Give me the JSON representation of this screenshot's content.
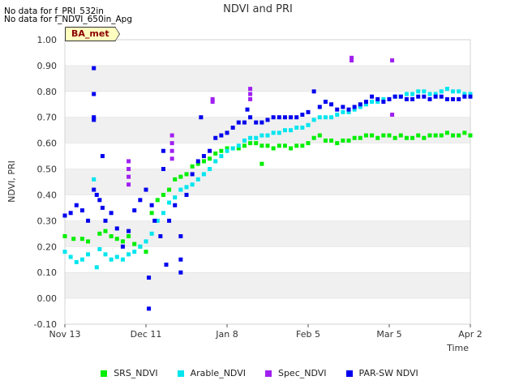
{
  "chart_data": {
    "type": "scatter",
    "title": "NDVI and PRI",
    "xlabel": "Time",
    "ylabel": "NDVI, PRI",
    "ylim": [
      -0.1,
      1.0
    ],
    "yticks": [
      -0.1,
      0.0,
      0.1,
      0.2,
      0.3,
      0.4,
      0.5,
      0.6,
      0.7,
      0.8,
      0.9,
      1.0
    ],
    "ytick_labels": [
      "-0.10",
      "0.00",
      "0.10",
      "0.20",
      "0.30",
      "0.40",
      "0.50",
      "0.60",
      "0.70",
      "0.80",
      "0.90",
      "1.00"
    ],
    "xlim_days": [
      0,
      140
    ],
    "xticks_days": [
      0,
      28,
      56,
      84,
      112,
      140
    ],
    "xtick_labels": [
      "Nov 13",
      "Dec 11",
      "Jan 8",
      "Feb 5",
      "Mar 5",
      "Apr 2"
    ],
    "grid": "horizontal bands",
    "legend_position": "bottom",
    "series": [
      {
        "name": "SRS_NDVI",
        "color": "#00ee00",
        "points": [
          [
            0,
            0.24
          ],
          [
            3,
            0.23
          ],
          [
            6,
            0.23
          ],
          [
            8,
            0.22
          ],
          [
            12,
            0.25
          ],
          [
            14,
            0.26
          ],
          [
            16,
            0.24
          ],
          [
            18,
            0.23
          ],
          [
            20,
            0.22
          ],
          [
            22,
            0.24
          ],
          [
            24,
            0.21
          ],
          [
            26,
            0.2
          ],
          [
            28,
            0.18
          ],
          [
            30,
            0.33
          ],
          [
            32,
            0.38
          ],
          [
            34,
            0.4
          ],
          [
            36,
            0.42
          ],
          [
            38,
            0.46
          ],
          [
            40,
            0.47
          ],
          [
            42,
            0.48
          ],
          [
            44,
            0.51
          ],
          [
            46,
            0.52
          ],
          [
            48,
            0.53
          ],
          [
            50,
            0.54
          ],
          [
            52,
            0.56
          ],
          [
            54,
            0.57
          ],
          [
            56,
            0.58
          ],
          [
            58,
            0.58
          ],
          [
            60,
            0.58
          ],
          [
            62,
            0.59
          ],
          [
            64,
            0.6
          ],
          [
            66,
            0.6
          ],
          [
            68,
            0.59
          ],
          [
            68,
            0.52
          ],
          [
            70,
            0.59
          ],
          [
            72,
            0.58
          ],
          [
            74,
            0.59
          ],
          [
            76,
            0.59
          ],
          [
            78,
            0.58
          ],
          [
            80,
            0.59
          ],
          [
            82,
            0.59
          ],
          [
            84,
            0.6
          ],
          [
            86,
            0.62
          ],
          [
            88,
            0.63
          ],
          [
            90,
            0.61
          ],
          [
            92,
            0.61
          ],
          [
            94,
            0.6
          ],
          [
            96,
            0.61
          ],
          [
            98,
            0.61
          ],
          [
            100,
            0.62
          ],
          [
            102,
            0.62
          ],
          [
            104,
            0.63
          ],
          [
            106,
            0.63
          ],
          [
            108,
            0.62
          ],
          [
            110,
            0.63
          ],
          [
            112,
            0.63
          ],
          [
            114,
            0.62
          ],
          [
            116,
            0.63
          ],
          [
            118,
            0.62
          ],
          [
            120,
            0.62
          ],
          [
            122,
            0.63
          ],
          [
            124,
            0.62
          ],
          [
            126,
            0.63
          ],
          [
            128,
            0.63
          ],
          [
            130,
            0.63
          ],
          [
            132,
            0.64
          ],
          [
            134,
            0.63
          ],
          [
            136,
            0.63
          ],
          [
            138,
            0.64
          ],
          [
            140,
            0.63
          ]
        ]
      },
      {
        "name": "Arable_NDVI",
        "color": "#00e5ee",
        "points": [
          [
            0,
            0.18
          ],
          [
            2,
            0.16
          ],
          [
            4,
            0.14
          ],
          [
            6,
            0.15
          ],
          [
            8,
            0.17
          ],
          [
            10,
            0.46
          ],
          [
            11,
            0.12
          ],
          [
            12,
            0.19
          ],
          [
            14,
            0.17
          ],
          [
            16,
            0.15
          ],
          [
            18,
            0.16
          ],
          [
            20,
            0.15
          ],
          [
            22,
            0.17
          ],
          [
            24,
            0.18
          ],
          [
            26,
            0.2
          ],
          [
            28,
            0.22
          ],
          [
            30,
            0.25
          ],
          [
            32,
            0.3
          ],
          [
            34,
            0.33
          ],
          [
            36,
            0.37
          ],
          [
            38,
            0.39
          ],
          [
            40,
            0.42
          ],
          [
            42,
            0.43
          ],
          [
            44,
            0.44
          ],
          [
            46,
            0.46
          ],
          [
            48,
            0.48
          ],
          [
            50,
            0.5
          ],
          [
            52,
            0.53
          ],
          [
            54,
            0.55
          ],
          [
            56,
            0.57
          ],
          [
            58,
            0.58
          ],
          [
            60,
            0.59
          ],
          [
            62,
            0.61
          ],
          [
            64,
            0.62
          ],
          [
            66,
            0.62
          ],
          [
            68,
            0.63
          ],
          [
            70,
            0.63
          ],
          [
            72,
            0.64
          ],
          [
            74,
            0.64
          ],
          [
            76,
            0.65
          ],
          [
            78,
            0.65
          ],
          [
            80,
            0.66
          ],
          [
            82,
            0.66
          ],
          [
            84,
            0.67
          ],
          [
            86,
            0.69
          ],
          [
            88,
            0.7
          ],
          [
            90,
            0.7
          ],
          [
            92,
            0.7
          ],
          [
            94,
            0.71
          ],
          [
            96,
            0.72
          ],
          [
            98,
            0.72
          ],
          [
            100,
            0.73
          ],
          [
            102,
            0.74
          ],
          [
            104,
            0.75
          ],
          [
            106,
            0.76
          ],
          [
            108,
            0.76
          ],
          [
            110,
            0.77
          ],
          [
            112,
            0.77
          ],
          [
            114,
            0.78
          ],
          [
            116,
            0.78
          ],
          [
            118,
            0.79
          ],
          [
            120,
            0.79
          ],
          [
            122,
            0.8
          ],
          [
            124,
            0.8
          ],
          [
            126,
            0.79
          ],
          [
            128,
            0.79
          ],
          [
            130,
            0.8
          ],
          [
            132,
            0.81
          ],
          [
            134,
            0.8
          ],
          [
            136,
            0.8
          ],
          [
            138,
            0.79
          ],
          [
            140,
            0.79
          ]
        ]
      },
      {
        "name": "Spec_NDVI",
        "color": "#a020f0",
        "points": [
          [
            22,
            0.53
          ],
          [
            22,
            0.5
          ],
          [
            22,
            0.47
          ],
          [
            22,
            0.44
          ],
          [
            37,
            0.63
          ],
          [
            37,
            0.6
          ],
          [
            37,
            0.57
          ],
          [
            37,
            0.54
          ],
          [
            51,
            0.77
          ],
          [
            51,
            0.76
          ],
          [
            64,
            0.81
          ],
          [
            64,
            0.79
          ],
          [
            64,
            0.77
          ],
          [
            99,
            0.93
          ],
          [
            99,
            0.92
          ],
          [
            113,
            0.92
          ],
          [
            113,
            0.71
          ]
        ]
      },
      {
        "name": "PAR-SW NDVI",
        "color": "#0000ee",
        "points": [
          [
            0,
            0.32
          ],
          [
            2,
            0.33
          ],
          [
            4,
            0.36
          ],
          [
            6,
            0.34
          ],
          [
            8,
            0.3
          ],
          [
            10,
            0.89
          ],
          [
            10,
            0.79
          ],
          [
            10,
            0.7
          ],
          [
            10,
            0.69
          ],
          [
            10,
            0.42
          ],
          [
            11,
            0.4
          ],
          [
            12,
            0.38
          ],
          [
            13,
            0.55
          ],
          [
            13,
            0.35
          ],
          [
            14,
            0.3
          ],
          [
            16,
            0.33
          ],
          [
            18,
            0.27
          ],
          [
            20,
            0.2
          ],
          [
            22,
            0.26
          ],
          [
            24,
            0.34
          ],
          [
            26,
            0.38
          ],
          [
            28,
            0.42
          ],
          [
            29,
            0.08
          ],
          [
            29,
            -0.04
          ],
          [
            30,
            0.36
          ],
          [
            31,
            0.3
          ],
          [
            33,
            0.24
          ],
          [
            34,
            0.57
          ],
          [
            34,
            0.5
          ],
          [
            35,
            0.13
          ],
          [
            36,
            0.3
          ],
          [
            38,
            0.36
          ],
          [
            40,
            0.24
          ],
          [
            40,
            0.1
          ],
          [
            40,
            0.15
          ],
          [
            42,
            0.4
          ],
          [
            44,
            0.48
          ],
          [
            46,
            0.53
          ],
          [
            47,
            0.7
          ],
          [
            48,
            0.55
          ],
          [
            50,
            0.57
          ],
          [
            52,
            0.62
          ],
          [
            54,
            0.63
          ],
          [
            56,
            0.64
          ],
          [
            58,
            0.66
          ],
          [
            60,
            0.68
          ],
          [
            62,
            0.68
          ],
          [
            63,
            0.73
          ],
          [
            64,
            0.7
          ],
          [
            66,
            0.68
          ],
          [
            68,
            0.68
          ],
          [
            70,
            0.69
          ],
          [
            72,
            0.7
          ],
          [
            74,
            0.7
          ],
          [
            76,
            0.7
          ],
          [
            78,
            0.7
          ],
          [
            80,
            0.7
          ],
          [
            82,
            0.71
          ],
          [
            84,
            0.72
          ],
          [
            86,
            0.8
          ],
          [
            88,
            0.74
          ],
          [
            90,
            0.76
          ],
          [
            92,
            0.75
          ],
          [
            94,
            0.73
          ],
          [
            96,
            0.74
          ],
          [
            98,
            0.73
          ],
          [
            100,
            0.74
          ],
          [
            102,
            0.75
          ],
          [
            104,
            0.76
          ],
          [
            106,
            0.78
          ],
          [
            108,
            0.77
          ],
          [
            110,
            0.76
          ],
          [
            112,
            0.77
          ],
          [
            114,
            0.78
          ],
          [
            116,
            0.78
          ],
          [
            118,
            0.77
          ],
          [
            120,
            0.77
          ],
          [
            122,
            0.78
          ],
          [
            124,
            0.78
          ],
          [
            126,
            0.77
          ],
          [
            128,
            0.78
          ],
          [
            130,
            0.78
          ],
          [
            132,
            0.77
          ],
          [
            134,
            0.77
          ],
          [
            136,
            0.77
          ],
          [
            138,
            0.78
          ],
          [
            140,
            0.78
          ]
        ]
      }
    ]
  },
  "no_data_lines": [
    "No data for f_PRI_532in",
    "No data for f_NDVI_650in_Apg"
  ],
  "badge_label": "BA_met",
  "legend": [
    {
      "label": "SRS_NDVI",
      "color": "#00ee00"
    },
    {
      "label": "Arable_NDVI",
      "color": "#00e5ee"
    },
    {
      "label": "Spec_NDVI",
      "color": "#a020f0"
    },
    {
      "label": "PAR-SW NDVI",
      "color": "#0000ee"
    }
  ]
}
